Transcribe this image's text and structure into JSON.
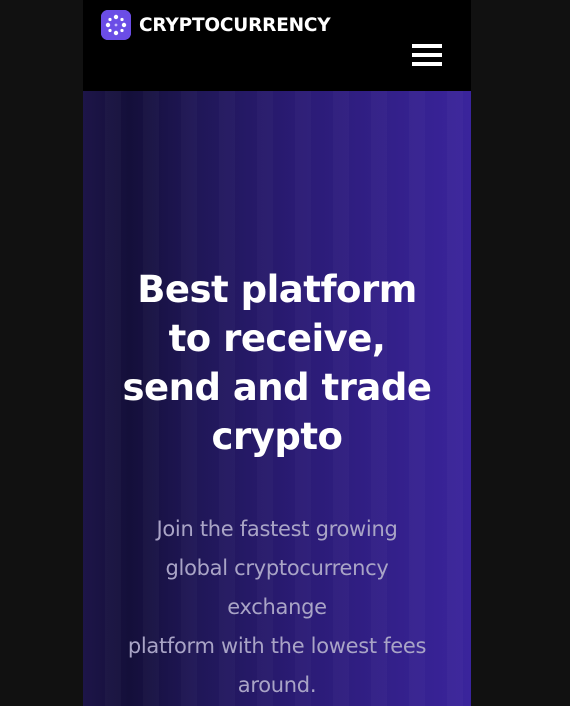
{
  "navbar": {
    "brand_name": "CRYPTOCURRENCY",
    "logo_icon": "grid-dots-logo-icon",
    "menu_icon": "hamburger-menu-icon"
  },
  "hero": {
    "headline_lines": [
      "Best platform",
      "to receive,",
      "send and trade",
      "crypto"
    ],
    "subtext_lines": [
      "Join the fastest growing",
      "global cryptocurrency",
      "exchange",
      "platform with the lowest fees",
      "around."
    ]
  },
  "colors": {
    "logo_bg": "#6b4de6",
    "hero_gradient_start": "#140f3a",
    "hero_gradient_end": "#3a249c",
    "subtext": "#a9a4c6"
  }
}
